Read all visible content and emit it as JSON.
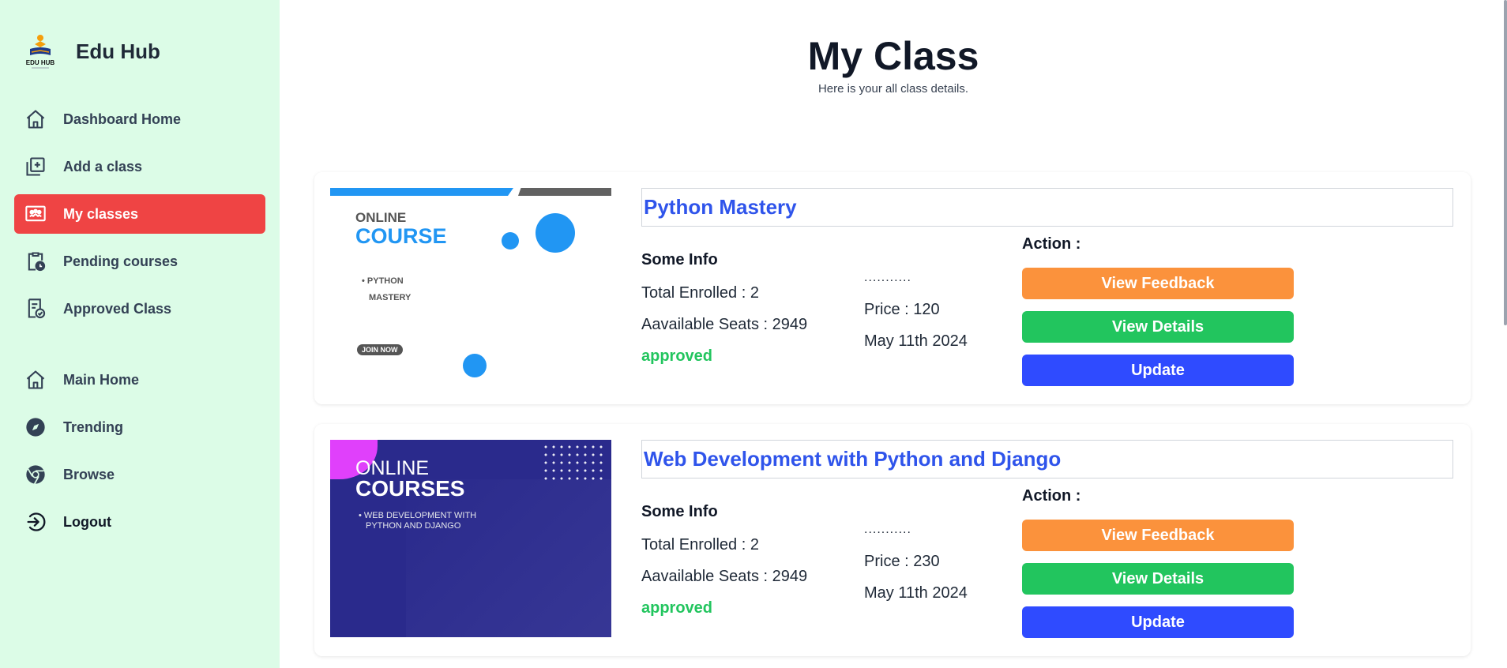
{
  "brand": {
    "title": "Edu Hub",
    "logo_text": "EDU HUB"
  },
  "sidebar": {
    "items": [
      {
        "label": "Dashboard Home",
        "icon": "home-icon"
      },
      {
        "label": "Add a class",
        "icon": "add-box-icon"
      },
      {
        "label": "My classes",
        "icon": "classroom-icon",
        "active": true
      },
      {
        "label": "Pending courses",
        "icon": "clipboard-clock-icon"
      },
      {
        "label": "Approved Class",
        "icon": "document-check-icon"
      }
    ],
    "secondary": [
      {
        "label": "Main Home",
        "icon": "home-icon"
      },
      {
        "label": "Trending",
        "icon": "compass-icon"
      },
      {
        "label": "Browse",
        "icon": "chrome-icon"
      },
      {
        "label": "Logout",
        "icon": "logout-icon"
      }
    ]
  },
  "header": {
    "title": "My Class",
    "subtitle": "Here is your all class details."
  },
  "classes": [
    {
      "title": "Python Mastery",
      "info_heading": "Some Info",
      "enrolled": "Total Enrolled : 2",
      "seats": "Aavailable Seats : 2949",
      "status": "approved",
      "dots": "...........",
      "price": "Price : 120",
      "date": "May 11th 2024",
      "action_heading": "Action :",
      "buttons": {
        "feedback": "View Feedback",
        "details": "View Details",
        "update": "Update"
      },
      "thumb": {
        "line1": "ONLINE",
        "line2": "COURSE",
        "bullet1": "• PYTHON",
        "bullet2": "MASTERY",
        "badge": "JOIN NOW"
      }
    },
    {
      "title": "Web Development with Python and Django",
      "info_heading": "Some Info",
      "enrolled": "Total Enrolled : 2",
      "seats": "Aavailable Seats : 2949",
      "status": "approved",
      "dots": "...........",
      "price": "Price : 230",
      "date": "May 11th 2024",
      "action_heading": "Action :",
      "buttons": {
        "feedback": "View Feedback",
        "details": "View Details",
        "update": "Update"
      },
      "thumb": {
        "line1": "ONLINE",
        "line2": "COURSES",
        "bullet1": "• WEB DEVELOPMENT WITH",
        "bullet2": "PYTHON AND DJANGO"
      }
    }
  ],
  "colors": {
    "sidebar_bg": "#dcfce7",
    "active": "#ef4444",
    "title_blue": "#2f54eb",
    "feedback": "#fb923c",
    "details": "#22c55e",
    "update": "#2f4bff",
    "status": "#22c55e"
  }
}
